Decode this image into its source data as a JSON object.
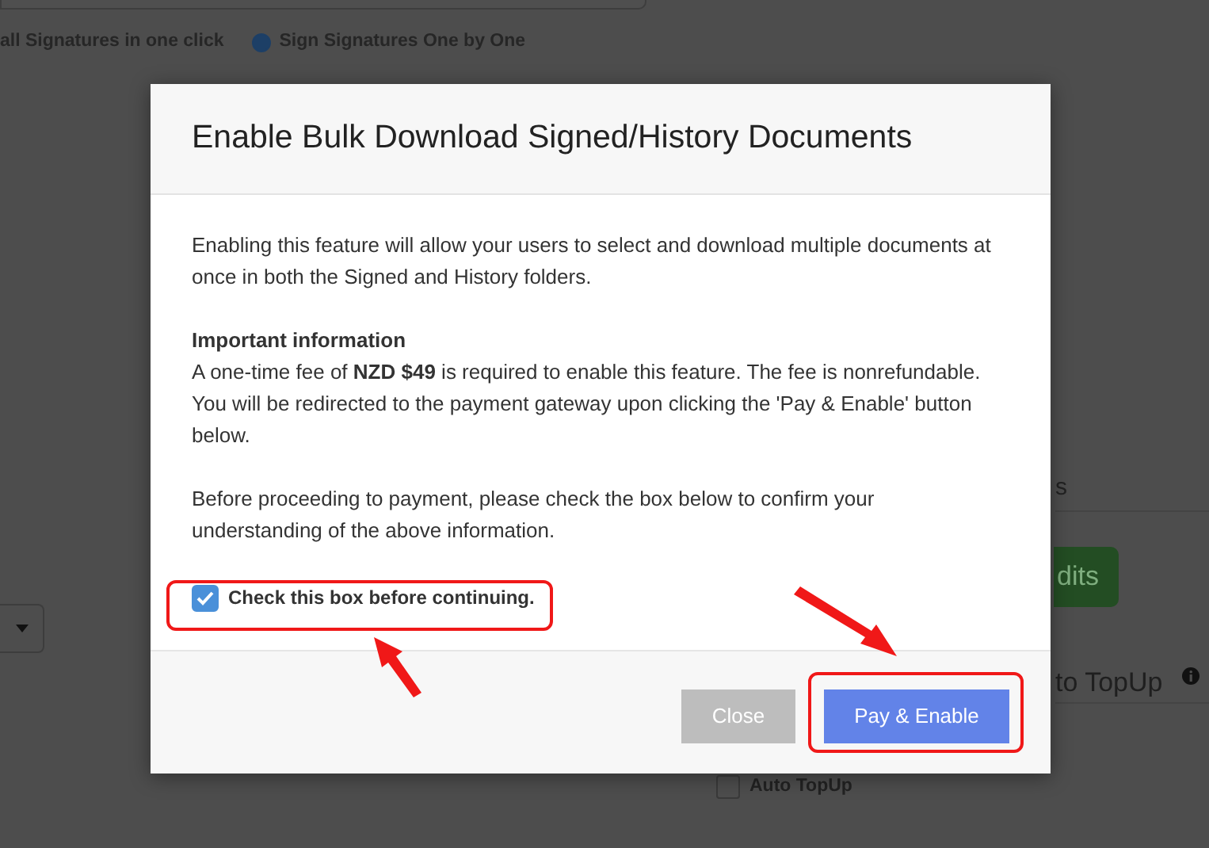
{
  "background": {
    "radio_row_text": "all Signatures in one click",
    "sign_option": {
      "label": "Sign Signatures One by One",
      "selected": true
    },
    "section_label": "s",
    "topup_button": "dits",
    "topup_heading": "to TopUp",
    "auto_topup": {
      "label": "Auto TopUp",
      "checked": false
    }
  },
  "modal": {
    "title": "Enable Bulk Download Signed/History Documents",
    "intro": "Enabling this feature will allow your users to select and download multiple documents at once in both the Signed and History folders.",
    "important_heading": "Important information",
    "important_text": "A one-time fee of **NZD $49** is required to enable this feature. The fee is nonrefundable. You will be redirected to the payment gateway upon clicking the 'Pay & Enable' button below.",
    "confirm_text": "Before proceeding to payment, please check the box below to confirm your understanding of the above information.",
    "checkbox": {
      "label": "Check this box before continuing.",
      "checked": true
    },
    "buttons": [
      {
        "label": "Close",
        "kind": "secondary"
      },
      {
        "label": "Pay & Enable",
        "kind": "primary"
      }
    ]
  }
}
